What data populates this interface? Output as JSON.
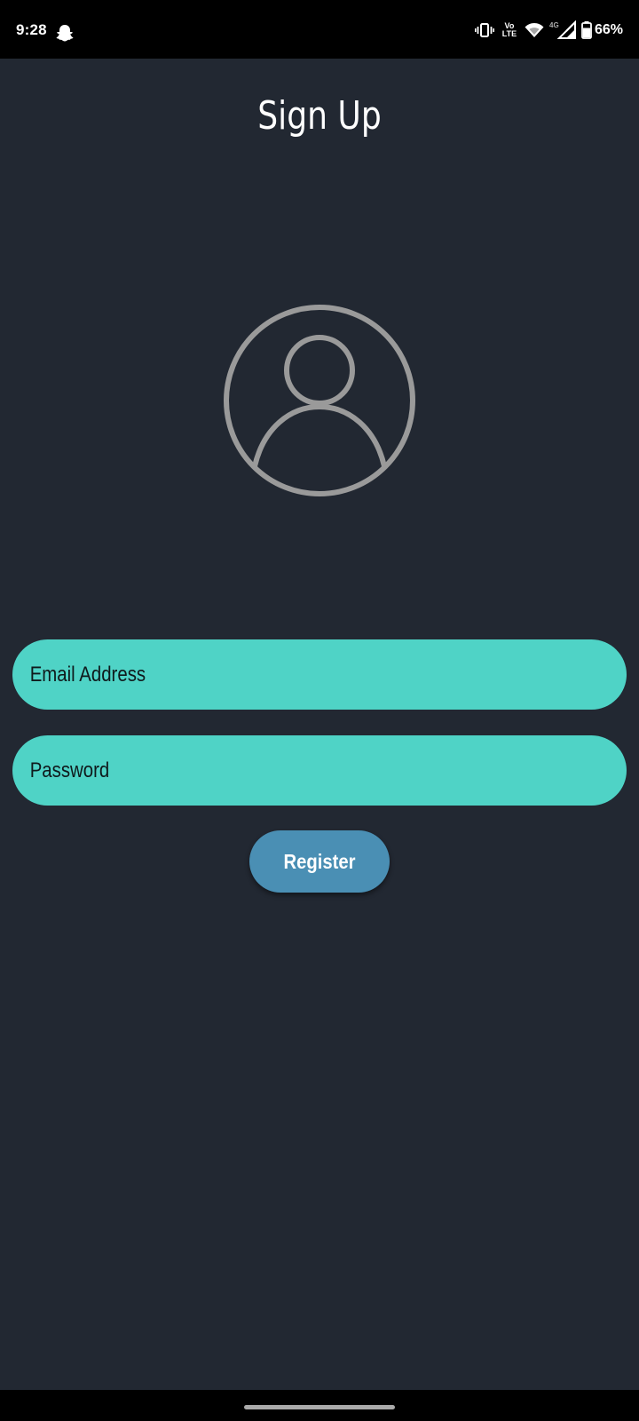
{
  "status_bar": {
    "time": "9:28",
    "network_volte_top": "Vo",
    "network_volte_bottom": "LTE",
    "network_type": "4G",
    "battery": "66%",
    "icons": [
      "snapchat-icon",
      "vibrate-icon",
      "volte-icon",
      "wifi-icon",
      "signal-icon",
      "battery-icon"
    ]
  },
  "screen": {
    "title": "Sign Up"
  },
  "form": {
    "email_placeholder": "Email Address",
    "password_placeholder": "Password",
    "register_label": "Register"
  },
  "colors": {
    "background": "#222832",
    "input_fill": "#4fd3c6",
    "button_fill": "#4a8fb4",
    "avatar_stroke": "#9a9a9a"
  }
}
